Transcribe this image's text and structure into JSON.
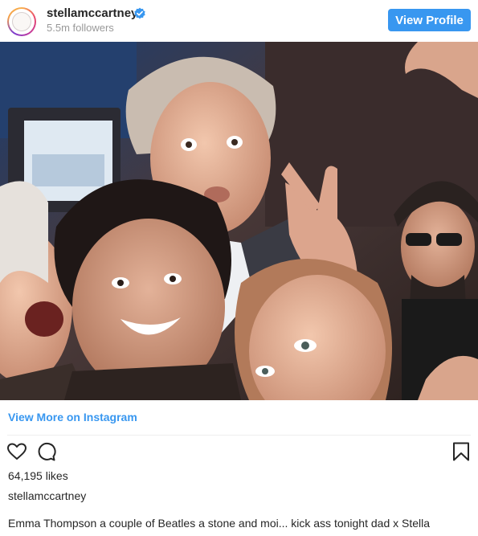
{
  "header": {
    "username": "stellamccartney",
    "verified": true,
    "followers": "5.5m followers",
    "view_profile_label": "View Profile"
  },
  "post": {
    "photo_icon": "group-selfie-photo",
    "view_more_label": "View More on Instagram",
    "likes": "64,195 likes",
    "owner": "stellamccartney",
    "caption": "Emma Thompson a couple of Beatles a stone and moi... kick ass tonight dad x Stella"
  },
  "actions": {
    "like_icon": "heart-icon",
    "comment_icon": "comment-icon",
    "save_icon": "bookmark-icon"
  },
  "colors": {
    "accent": "#3897f0",
    "text": "#262626",
    "muted": "#999999"
  }
}
